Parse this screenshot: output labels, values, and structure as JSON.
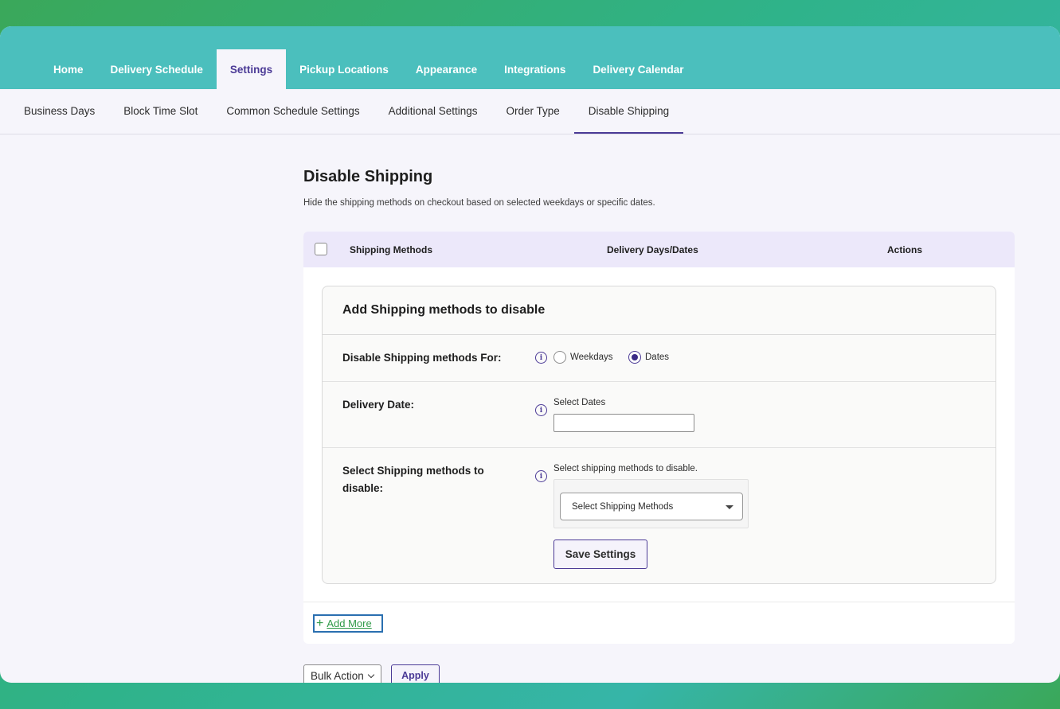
{
  "top_nav": {
    "tabs": [
      {
        "label": "Home"
      },
      {
        "label": "Delivery Schedule"
      },
      {
        "label": "Settings"
      },
      {
        "label": "Pickup Locations"
      },
      {
        "label": "Appearance"
      },
      {
        "label": "Integrations"
      },
      {
        "label": "Delivery Calendar"
      }
    ],
    "active": "Settings"
  },
  "sub_nav": {
    "tabs": [
      {
        "label": "Business Days"
      },
      {
        "label": "Block Time Slot"
      },
      {
        "label": "Common Schedule Settings"
      },
      {
        "label": "Additional Settings"
      },
      {
        "label": "Order Type"
      },
      {
        "label": "Disable Shipping"
      }
    ],
    "active": "Disable Shipping"
  },
  "page": {
    "title": "Disable Shipping",
    "description": "Hide the shipping methods on checkout based on selected weekdays or specific dates."
  },
  "table": {
    "headers": {
      "shipping_methods": "Shipping Methods",
      "delivery_days": "Delivery Days/Dates",
      "actions": "Actions"
    }
  },
  "form": {
    "title": "Add Shipping methods to disable",
    "disable_for": {
      "label": "Disable Shipping methods For:",
      "options": [
        "Weekdays",
        "Dates"
      ],
      "selected": "Dates"
    },
    "delivery_date": {
      "label": "Delivery Date:",
      "field_label": "Select Dates",
      "value": ""
    },
    "shipping_methods": {
      "label": "Select Shipping methods to disable:",
      "hint": "Select shipping methods to disable.",
      "placeholder": "Select Shipping Methods"
    },
    "save_label": "Save Settings"
  },
  "footer": {
    "add_more": "Add More",
    "bulk_action": "Bulk Action",
    "apply": "Apply"
  }
}
